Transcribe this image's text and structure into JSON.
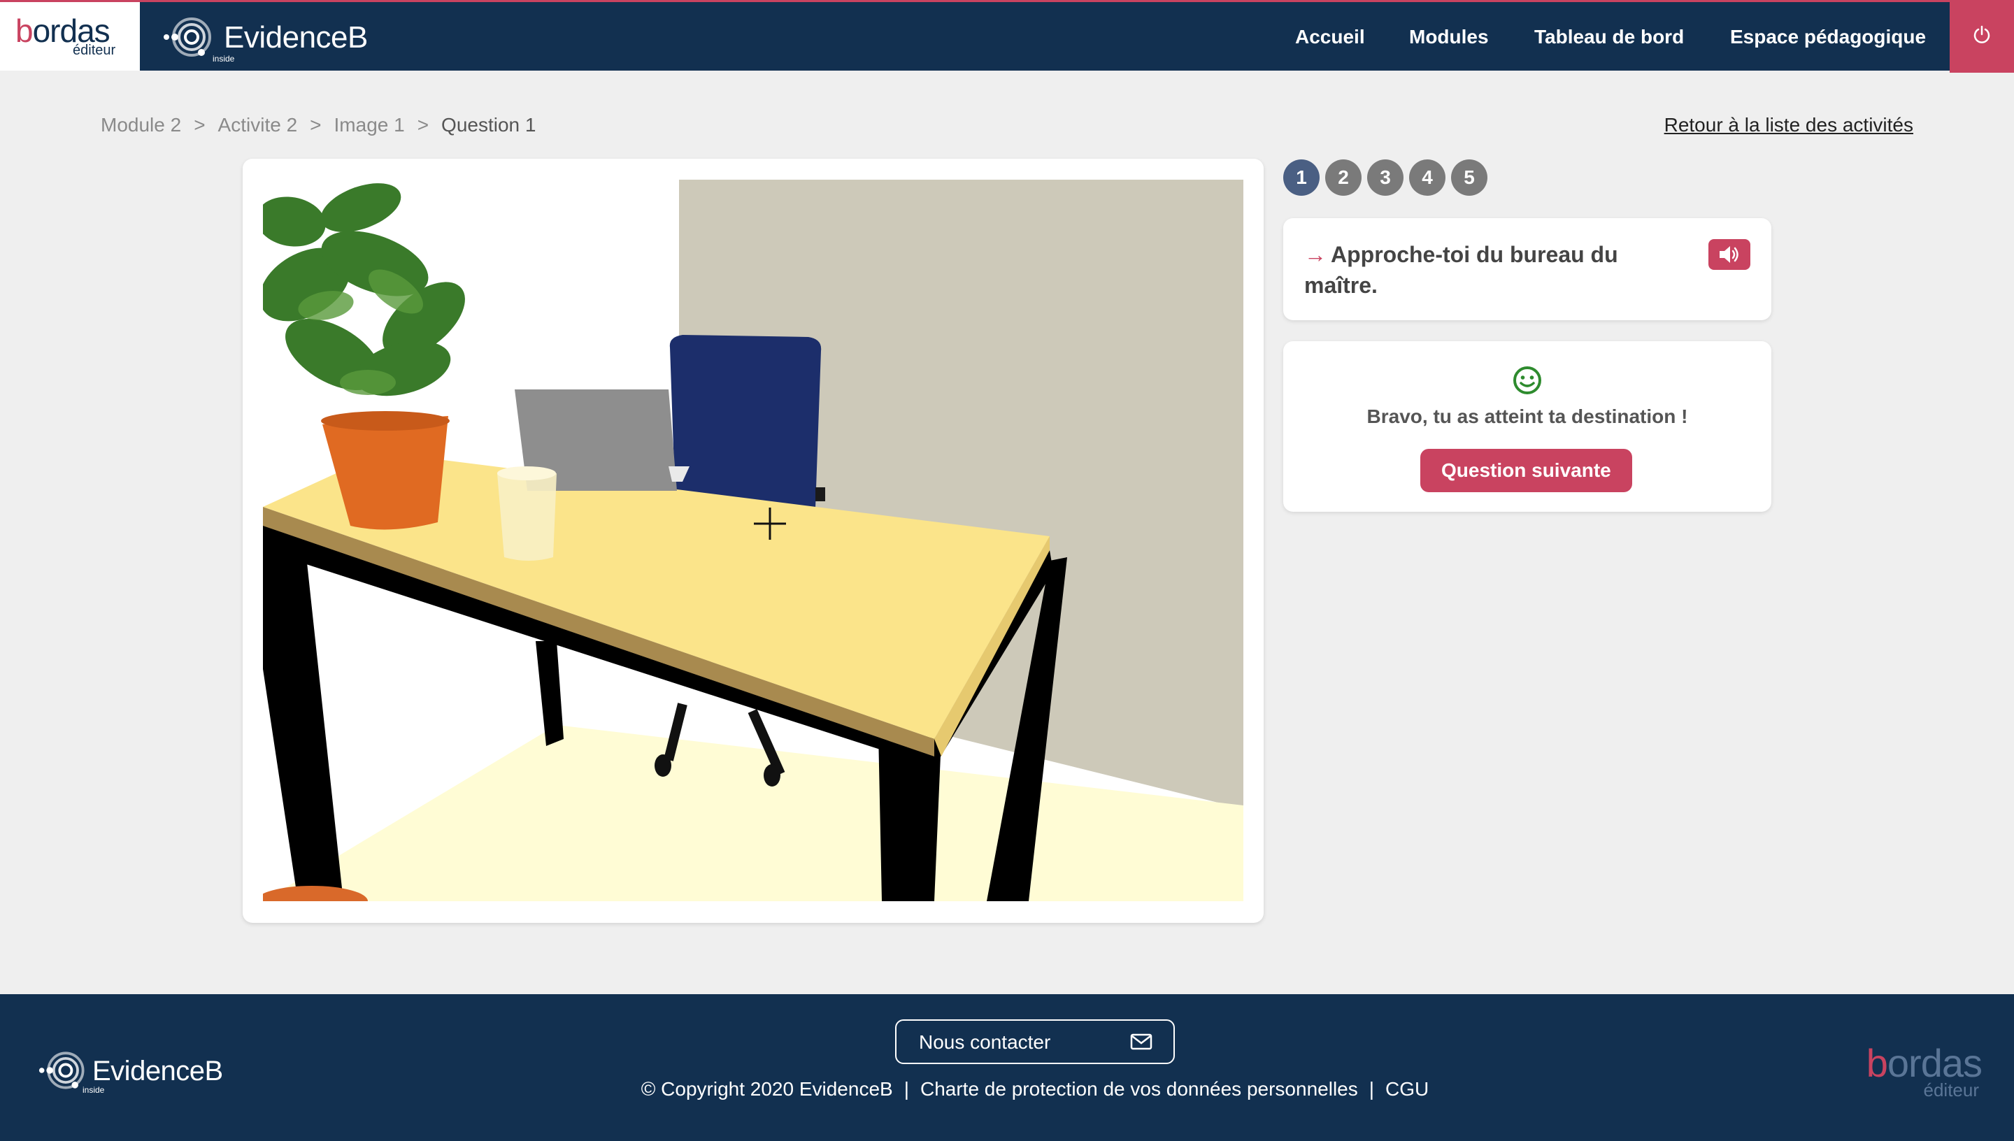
{
  "header": {
    "bordas_logo": {
      "name": "bordas",
      "subtitle": "éditeur"
    },
    "evidenceb_logo": {
      "name": "EvidenceB",
      "subtitle": "inside"
    },
    "nav": [
      {
        "label": "Accueil"
      },
      {
        "label": "Modules"
      },
      {
        "label": "Tableau de bord"
      },
      {
        "label": "Espace pédagogique"
      }
    ],
    "power_icon": "power-icon"
  },
  "breadcrumb": {
    "items": [
      "Module 2",
      "Activite 2",
      "Image 1",
      "Question 1"
    ],
    "separator": ">"
  },
  "back_link": "Retour à la liste des activités",
  "pager": {
    "pages": [
      "1",
      "2",
      "3",
      "4",
      "5"
    ],
    "active": 1
  },
  "instruction": {
    "text": "Approche-toi du bureau du maître.",
    "arrow_icon": "arrow-right-icon",
    "audio_icon": "speaker-icon"
  },
  "feedback": {
    "icon": "smiley-icon",
    "message": "Bravo, tu as atteint ta destination !",
    "next_button": "Question suivante"
  },
  "scene": {
    "description_icons": [
      "plant",
      "laptop",
      "glass",
      "chair",
      "desk",
      "crosshair-icon"
    ]
  },
  "footer": {
    "contact_label": "Nous contacter",
    "contact_icon": "mail-icon",
    "copyright": "© Copyright 2020 EvidenceB",
    "privacy": "Charte de protection de vos données personnelles",
    "cgu": "CGU",
    "link_separator": "|"
  },
  "colors": {
    "navy": "#123050",
    "accent": "#c94360",
    "page_active": "#4a5f83",
    "page_inactive": "#7a7a7a",
    "success": "#2e8b2e"
  }
}
